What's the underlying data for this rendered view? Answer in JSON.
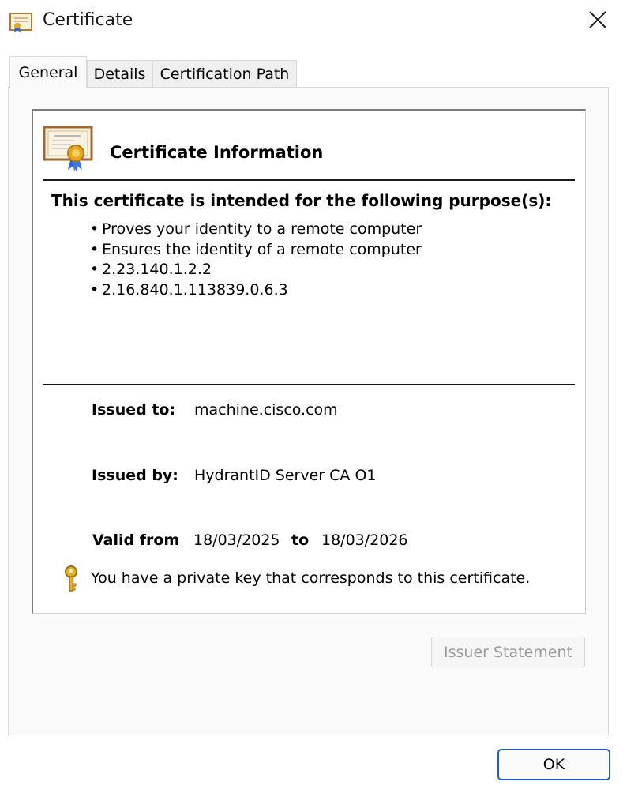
{
  "window": {
    "title": "Certificate"
  },
  "tabs": [
    {
      "label": "General",
      "active": true
    },
    {
      "label": "Details",
      "active": false
    },
    {
      "label": "Certification Path",
      "active": false
    }
  ],
  "info": {
    "heading": "Certificate Information",
    "purpose_heading": "This certificate is intended for the following purpose(s):",
    "purposes": [
      "Proves your identity to a remote computer",
      "Ensures the identity of a remote computer",
      "2.23.140.1.2.2",
      "2.16.840.1.113839.0.6.3"
    ],
    "bullet": "•",
    "issued_to_label": "Issued to:",
    "issued_to_value": "machine.cisco.com",
    "issued_by_label": "Issued by:",
    "issued_by_value": "HydrantID Server CA O1",
    "valid_from_label": "Valid from",
    "valid_from_value": "18/03/2025",
    "valid_to_label": "to",
    "valid_to_value": "18/03/2026",
    "private_key_note": "You have a private key that corresponds to this certificate."
  },
  "buttons": {
    "issuer_statement": "Issuer Statement",
    "ok": "OK"
  },
  "icons": {
    "window": "certificate-icon",
    "close": "close-icon",
    "info": "certificate-icon",
    "key": "key-icon"
  },
  "colors": {
    "ok_border": "#1f5fbf",
    "disabled_text": "#9a9a9a",
    "key_gold": "#d9a520"
  }
}
